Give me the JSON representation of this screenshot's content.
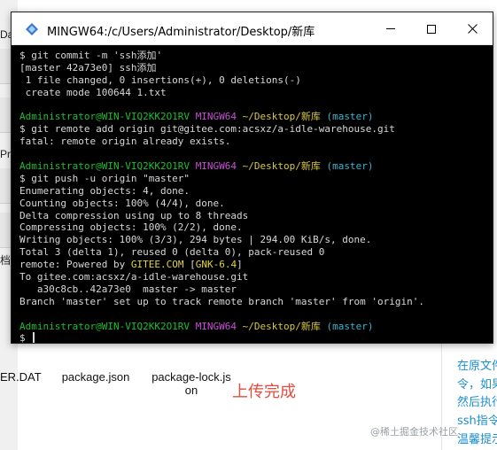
{
  "window": {
    "title": "MINGW64:/c/Users/Administrator/Desktop/新库"
  },
  "terminal": {
    "lines": [
      [
        {
          "t": "$ git commit -m 'ssh添加'",
          "c": "w"
        }
      ],
      [
        {
          "t": "[master 42a73e0] ssh添加",
          "c": "w"
        }
      ],
      [
        {
          "t": " 1 file changed, 0 insertions(+), 0 deletions(-)",
          "c": "w"
        }
      ],
      [
        {
          "t": " create mode 100644 1.txt",
          "c": "w"
        }
      ],
      [
        {
          "t": "",
          "c": "w"
        }
      ],
      [
        {
          "t": "Administrator@WIN-VIQ2KK2O1RV ",
          "c": "g"
        },
        {
          "t": "MINGW64 ",
          "c": "m"
        },
        {
          "t": "~/Desktop/新库 ",
          "c": "y"
        },
        {
          "t": "(master)",
          "c": "c"
        }
      ],
      [
        {
          "t": "$ git remote add origin git@gitee.com:acsxz/a-idle-warehouse.git",
          "c": "w"
        }
      ],
      [
        {
          "t": "fatal: remote origin already exists.",
          "c": "w"
        }
      ],
      [
        {
          "t": "",
          "c": "w"
        }
      ],
      [
        {
          "t": "Administrator@WIN-VIQ2KK2O1RV ",
          "c": "g"
        },
        {
          "t": "MINGW64 ",
          "c": "m"
        },
        {
          "t": "~/Desktop/新库 ",
          "c": "y"
        },
        {
          "t": "(master)",
          "c": "c"
        }
      ],
      [
        {
          "t": "$ git push -u origin \"master\"",
          "c": "w"
        }
      ],
      [
        {
          "t": "Enumerating objects: 4, done.",
          "c": "w"
        }
      ],
      [
        {
          "t": "Counting objects: 100% (4/4), done.",
          "c": "w"
        }
      ],
      [
        {
          "t": "Delta compression using up to 8 threads",
          "c": "w"
        }
      ],
      [
        {
          "t": "Compressing objects: 100% (2/2), done.",
          "c": "w"
        }
      ],
      [
        {
          "t": "Writing objects: 100% (3/3), 294 bytes | 294.00 KiB/s, done.",
          "c": "w"
        }
      ],
      [
        {
          "t": "Total 3 (delta 1), reused 0 (delta 0), pack-reused 0",
          "c": "w"
        }
      ],
      [
        {
          "t": "remote: Powered by ",
          "c": "w"
        },
        {
          "t": "GITEE.COM",
          "c": "gt"
        },
        {
          "t": " [",
          "c": "w"
        },
        {
          "t": "GNK-6.4",
          "c": "gt"
        },
        {
          "t": "]",
          "c": "w"
        }
      ],
      [
        {
          "t": "To gitee.com:acsxz/a-idle-warehouse.git",
          "c": "w"
        }
      ],
      [
        {
          "t": "   a30c8cb..42a73e0  master -> master",
          "c": "w"
        }
      ],
      [
        {
          "t": "Branch 'master' set up to track remote branch 'master' from 'origin'.",
          "c": "w"
        }
      ],
      [
        {
          "t": "",
          "c": "w"
        }
      ],
      [
        {
          "t": "Administrator@WIN-VIQ2KK2O1RV ",
          "c": "g"
        },
        {
          "t": "MINGW64 ",
          "c": "m"
        },
        {
          "t": "~/Desktop/新库 ",
          "c": "y"
        },
        {
          "t": "(master)",
          "c": "c"
        }
      ],
      [
        {
          "t": "$ ",
          "c": "w"
        }
      ]
    ]
  },
  "background": {
    "left_labels": [
      "Dat",
      "Pro",
      "档"
    ],
    "files": [
      {
        "name": "ER.DAT"
      },
      {
        "name": "package.json"
      },
      {
        "name": "package-lock.js"
      },
      {
        "name": "on"
      }
    ],
    "upload_note": "上传完成",
    "right_text": [
      "在原文件",
      "令，如果",
      "然后执行",
      "ssh指令",
      "温馨提示"
    ],
    "watermark": "@稀土掘金技术社区"
  },
  "colors": {
    "green": "#1bbf2c",
    "magenta": "#c94fd7",
    "yellow": "#d7c83b",
    "cyan": "#35b6cf",
    "text": "#d8d8d8",
    "note": "#e64b3c"
  },
  "icons": {
    "app": "mingw-diamond-icon",
    "minimize": "minimize-icon",
    "maximize": "maximize-icon",
    "close": "close-icon"
  }
}
